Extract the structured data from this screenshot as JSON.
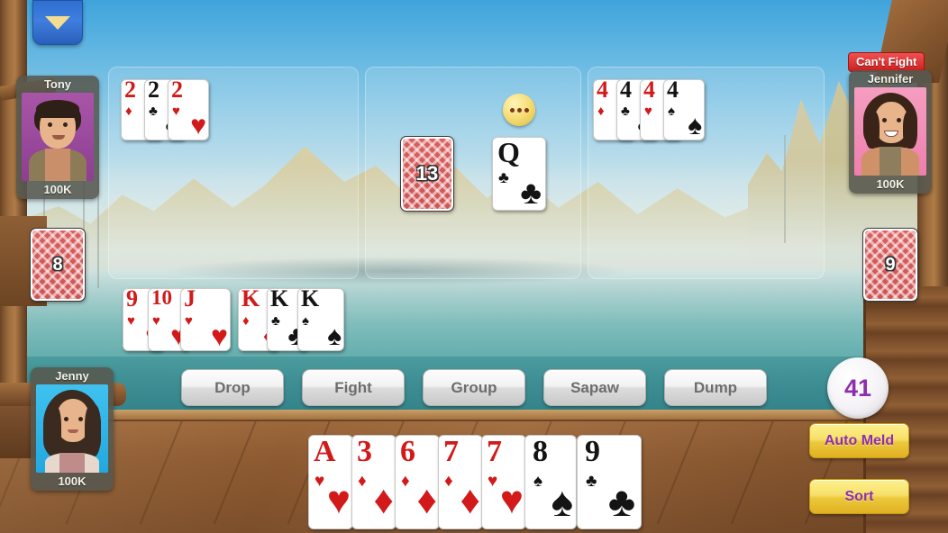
{
  "game": {
    "title": "Tongits Card Game Table",
    "menu_icon": "chevron-down-icon",
    "emoji_icon": "ellipsis-emoji-icon"
  },
  "players": [
    {
      "id": "tony",
      "name": "Tony",
      "chips": "100K",
      "avatar_bg": "#9c46a0",
      "position": "top-left"
    },
    {
      "id": "jennifer",
      "name": "Jennifer",
      "chips": "100K",
      "avatar_bg": "#f08cb4",
      "position": "top-right",
      "badge": "Can't Fight"
    },
    {
      "id": "jenny",
      "name": "Jenny",
      "chips": "100K",
      "avatar_bg": "#2eb5e8",
      "position": "bottom-left"
    }
  ],
  "badges": {
    "cant_fight": "Can't Fight"
  },
  "piles": {
    "tony_stock": {
      "count": "8",
      "label": "8"
    },
    "jennifer_stock": {
      "count": "9",
      "label": "9"
    },
    "draw_pile": {
      "count": "13",
      "label": "13"
    },
    "discard_top": {
      "rank": "Q",
      "suit": "clubs",
      "suit_glyph": "♣",
      "color": "#141414"
    }
  },
  "melds": [
    {
      "zone": "meld-zone-left",
      "owner": "tony",
      "cards": [
        {
          "rank": "2",
          "suit": "diamonds",
          "suit_glyph": "♦",
          "color": "#d11a19"
        },
        {
          "rank": "2",
          "suit": "clubs",
          "suit_glyph": "♣",
          "color": "#141414"
        },
        {
          "rank": "2",
          "suit": "hearts",
          "suit_glyph": "♥",
          "color": "#d11a19"
        }
      ]
    },
    {
      "zone": "meld-zone-center",
      "owner": "table",
      "cards": []
    },
    {
      "zone": "meld-zone-right",
      "owner": "jennifer",
      "cards": [
        {
          "rank": "4",
          "suit": "diamonds",
          "suit_glyph": "♦",
          "color": "#d11a19"
        },
        {
          "rank": "4",
          "suit": "clubs",
          "suit_glyph": "♣",
          "color": "#141414"
        },
        {
          "rank": "4",
          "suit": "hearts",
          "suit_glyph": "♥",
          "color": "#d11a19"
        },
        {
          "rank": "4",
          "suit": "spades",
          "suit_glyph": "♠",
          "color": "#141414"
        }
      ]
    }
  ],
  "player_melds": [
    {
      "name": "run-hearts",
      "cards": [
        {
          "rank": "9",
          "suit": "hearts",
          "suit_glyph": "♥",
          "color": "#d11a19"
        },
        {
          "rank": "10",
          "suit": "hearts",
          "suit_glyph": "♥",
          "color": "#d11a19"
        },
        {
          "rank": "J",
          "suit": "hearts",
          "suit_glyph": "♥",
          "color": "#d11a19"
        }
      ]
    },
    {
      "name": "set-kings",
      "cards": [
        {
          "rank": "K",
          "suit": "diamonds",
          "suit_glyph": "♦",
          "color": "#d11a19"
        },
        {
          "rank": "K",
          "suit": "clubs",
          "suit_glyph": "♣",
          "color": "#141414"
        },
        {
          "rank": "K",
          "suit": "spades",
          "suit_glyph": "♠",
          "color": "#141414"
        }
      ]
    }
  ],
  "hand": {
    "cards": [
      {
        "rank": "A",
        "suit": "hearts",
        "suit_glyph": "♥",
        "color": "#d11a19"
      },
      {
        "rank": "3",
        "suit": "diamonds",
        "suit_glyph": "♦",
        "color": "#d11a19"
      },
      {
        "rank": "6",
        "suit": "diamonds",
        "suit_glyph": "♦",
        "color": "#d11a19"
      },
      {
        "rank": "7",
        "suit": "diamonds",
        "suit_glyph": "♦",
        "color": "#d11a19"
      },
      {
        "rank": "7",
        "suit": "hearts",
        "suit_glyph": "♥",
        "color": "#d11a19"
      },
      {
        "rank": "8",
        "suit": "spades",
        "suit_glyph": "♠",
        "color": "#141414"
      },
      {
        "rank": "9",
        "suit": "clubs",
        "suit_glyph": "♣",
        "color": "#141414"
      }
    ]
  },
  "actions": [
    {
      "id": "drop",
      "label": "Drop"
    },
    {
      "id": "fight",
      "label": "Fight"
    },
    {
      "id": "group",
      "label": "Group"
    },
    {
      "id": "sapaw",
      "label": "Sapaw"
    },
    {
      "id": "dump",
      "label": "Dump"
    }
  ],
  "side_controls": {
    "score": "41",
    "auto_meld_label": "Auto Meld",
    "sort_label": "Sort"
  },
  "colors": {
    "accent_purple": "#8d2fb0",
    "yellow_button": "#f0d24a",
    "danger_red": "#d52525",
    "card_red": "#d11a19",
    "card_black": "#141414",
    "water_teal": "#3d8f93",
    "deck_brown": "#8d5a31"
  }
}
